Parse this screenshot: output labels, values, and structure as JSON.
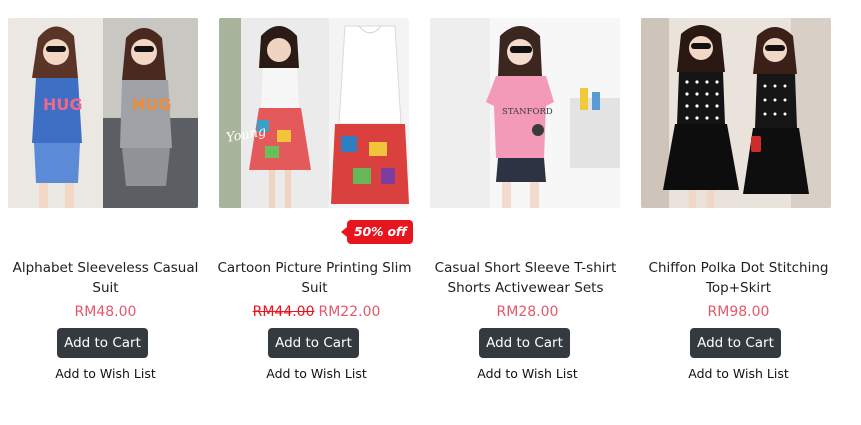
{
  "products": [
    {
      "name": "Alphabet Sleeveless Casual Suit",
      "old_price": "",
      "price": "RM48.00",
      "badge": "",
      "add_to_cart": "Add to Cart",
      "wish_list": "Add to Wish List",
      "image_label": "HUG"
    },
    {
      "name": "Cartoon Picture Printing Slim Suit",
      "old_price": "RM44.00",
      "price": "RM22.00",
      "badge": "50% off",
      "add_to_cart": "Add to Cart",
      "wish_list": "Add to Wish List",
      "image_label": "Young"
    },
    {
      "name": "Casual Short Sleeve T-shirt Shorts Activewear Sets",
      "old_price": "",
      "price": "RM28.00",
      "badge": "",
      "add_to_cart": "Add to Cart",
      "wish_list": "Add to Wish List",
      "image_label": "STANFORD"
    },
    {
      "name": "Chiffon Polka Dot Stitching Top+Skirt",
      "old_price": "",
      "price": "RM98.00",
      "badge": "",
      "add_to_cart": "Add to Cart",
      "wish_list": "Add to Wish List",
      "image_label": ""
    }
  ],
  "colors": {
    "price": "#e4576b",
    "sale_badge": "#e8141e",
    "button": "#343a40"
  }
}
